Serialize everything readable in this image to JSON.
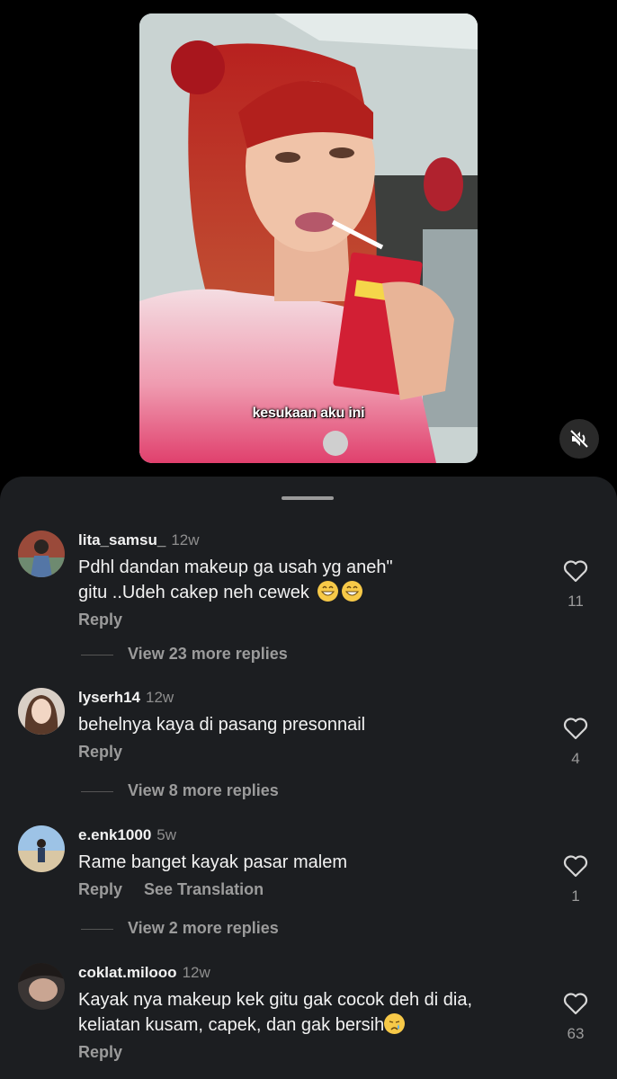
{
  "video": {
    "caption": "kesukaan aku ini",
    "mute_icon": "speaker-muted-icon"
  },
  "comments": [
    {
      "username": "lita_samsu_",
      "time": "12w",
      "text_lines": [
        "Pdhl dandan makeup ga usah  yg aneh\"",
        "gitu ..Udeh cakep neh cewek"
      ],
      "emojis": [
        "grinning-face",
        "grinning-face"
      ],
      "reply_label": "Reply",
      "view_replies": "View 23 more replies",
      "likes": "11"
    },
    {
      "username": "lyserh14",
      "time": "12w",
      "text_lines": [
        "behelnya kaya di pasang presonnail"
      ],
      "reply_label": "Reply",
      "view_replies": "View 8 more replies",
      "likes": "4"
    },
    {
      "username": "e.enk1000",
      "time": "5w",
      "text_lines": [
        "Rame banget kayak pasar malem"
      ],
      "reply_label": "Reply",
      "translate_label": "See Translation",
      "view_replies": "View 2 more replies",
      "likes": "1"
    },
    {
      "username": "coklat.milooo",
      "time": "12w",
      "text_lines": [
        "Kayak nya makeup kek gitu gak cocok deh di dia,",
        "keliatan kusam, capek, dan gak bersih"
      ],
      "emojis": [
        "crying-face"
      ],
      "reply_label": "Reply",
      "likes": "63"
    }
  ],
  "colors": {
    "sheet_bg": "#1c1e21",
    "text_primary": "#f2f2f2",
    "text_secondary": "#9b9b9b"
  }
}
